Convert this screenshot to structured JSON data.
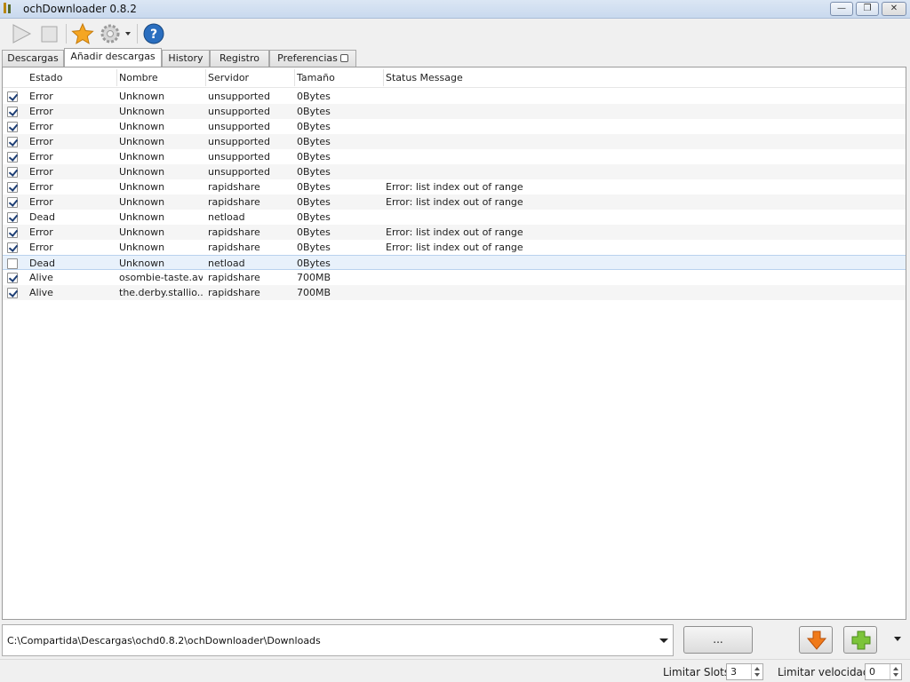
{
  "window": {
    "title": "ochDownloader 0.8.2",
    "buttons": {
      "minimize": "—",
      "maximize": "❐",
      "close": "✕"
    }
  },
  "toolbar": {
    "items": [
      {
        "name": "play-icon",
        "enabled": false
      },
      {
        "name": "stop-icon",
        "enabled": false
      },
      {
        "name": "star-icon",
        "enabled": true
      },
      {
        "name": "gear-icon",
        "enabled": false
      },
      {
        "name": "help-icon",
        "enabled": true
      }
    ]
  },
  "tabs": [
    {
      "label": "Descargas"
    },
    {
      "label": "Añadir descargas",
      "active": true
    },
    {
      "label": "History"
    },
    {
      "label": "Registro"
    },
    {
      "label": "Preferencias"
    }
  ],
  "table": {
    "columns": [
      "Estado",
      "Nombre",
      "Servidor",
      "Tamaño",
      "Status Message"
    ],
    "rows": [
      {
        "checked": true,
        "estado": "Error",
        "nombre": "Unknown",
        "servidor": "unsupported",
        "tamano": "0Bytes",
        "status": ""
      },
      {
        "checked": true,
        "estado": "Error",
        "nombre": "Unknown",
        "servidor": "unsupported",
        "tamano": "0Bytes",
        "status": ""
      },
      {
        "checked": true,
        "estado": "Error",
        "nombre": "Unknown",
        "servidor": "unsupported",
        "tamano": "0Bytes",
        "status": ""
      },
      {
        "checked": true,
        "estado": "Error",
        "nombre": "Unknown",
        "servidor": "unsupported",
        "tamano": "0Bytes",
        "status": ""
      },
      {
        "checked": true,
        "estado": "Error",
        "nombre": "Unknown",
        "servidor": "unsupported",
        "tamano": "0Bytes",
        "status": ""
      },
      {
        "checked": true,
        "estado": "Error",
        "nombre": "Unknown",
        "servidor": "unsupported",
        "tamano": "0Bytes",
        "status": ""
      },
      {
        "checked": true,
        "estado": "Error",
        "nombre": "Unknown",
        "servidor": "rapidshare",
        "tamano": "0Bytes",
        "status": "Error: list index out of range"
      },
      {
        "checked": true,
        "estado": "Error",
        "nombre": "Unknown",
        "servidor": "rapidshare",
        "tamano": "0Bytes",
        "status": "Error: list index out of range"
      },
      {
        "checked": true,
        "estado": "Dead",
        "nombre": "Unknown",
        "servidor": "netload",
        "tamano": "0Bytes",
        "status": ""
      },
      {
        "checked": true,
        "estado": "Error",
        "nombre": "Unknown",
        "servidor": "rapidshare",
        "tamano": "0Bytes",
        "status": "Error: list index out of range"
      },
      {
        "checked": true,
        "estado": "Error",
        "nombre": "Unknown",
        "servidor": "rapidshare",
        "tamano": "0Bytes",
        "status": "Error: list index out of range"
      },
      {
        "checked": false,
        "estado": "Dead",
        "nombre": "Unknown",
        "servidor": "netload",
        "tamano": "0Bytes",
        "status": "",
        "selected": true
      },
      {
        "checked": true,
        "estado": "Alive",
        "nombre": "osombie-taste.avi",
        "servidor": "rapidshare",
        "tamano": "700MB",
        "status": ""
      },
      {
        "checked": true,
        "estado": "Alive",
        "nombre": "the.derby.stallio...",
        "servidor": "rapidshare",
        "tamano": "700MB",
        "status": ""
      }
    ]
  },
  "path": {
    "value": "C:\\Compartida\\Descargas\\ochd0.8.2\\ochDownloader\\Downloads"
  },
  "buttons": {
    "browse": "...",
    "download_icon": "arrow-down-icon",
    "add_icon": "plus-icon"
  },
  "status": {
    "slots_label": "Limitar Slots",
    "slots_value": "3",
    "speed_label": "Limitar velocidad",
    "speed_value": "0"
  },
  "colors": {
    "star": "#f5a623",
    "help": "#2a6ebf",
    "download_arrow": "#f07a1a",
    "add_plus": "#7cc43a",
    "selection": "#e8f1fb"
  }
}
